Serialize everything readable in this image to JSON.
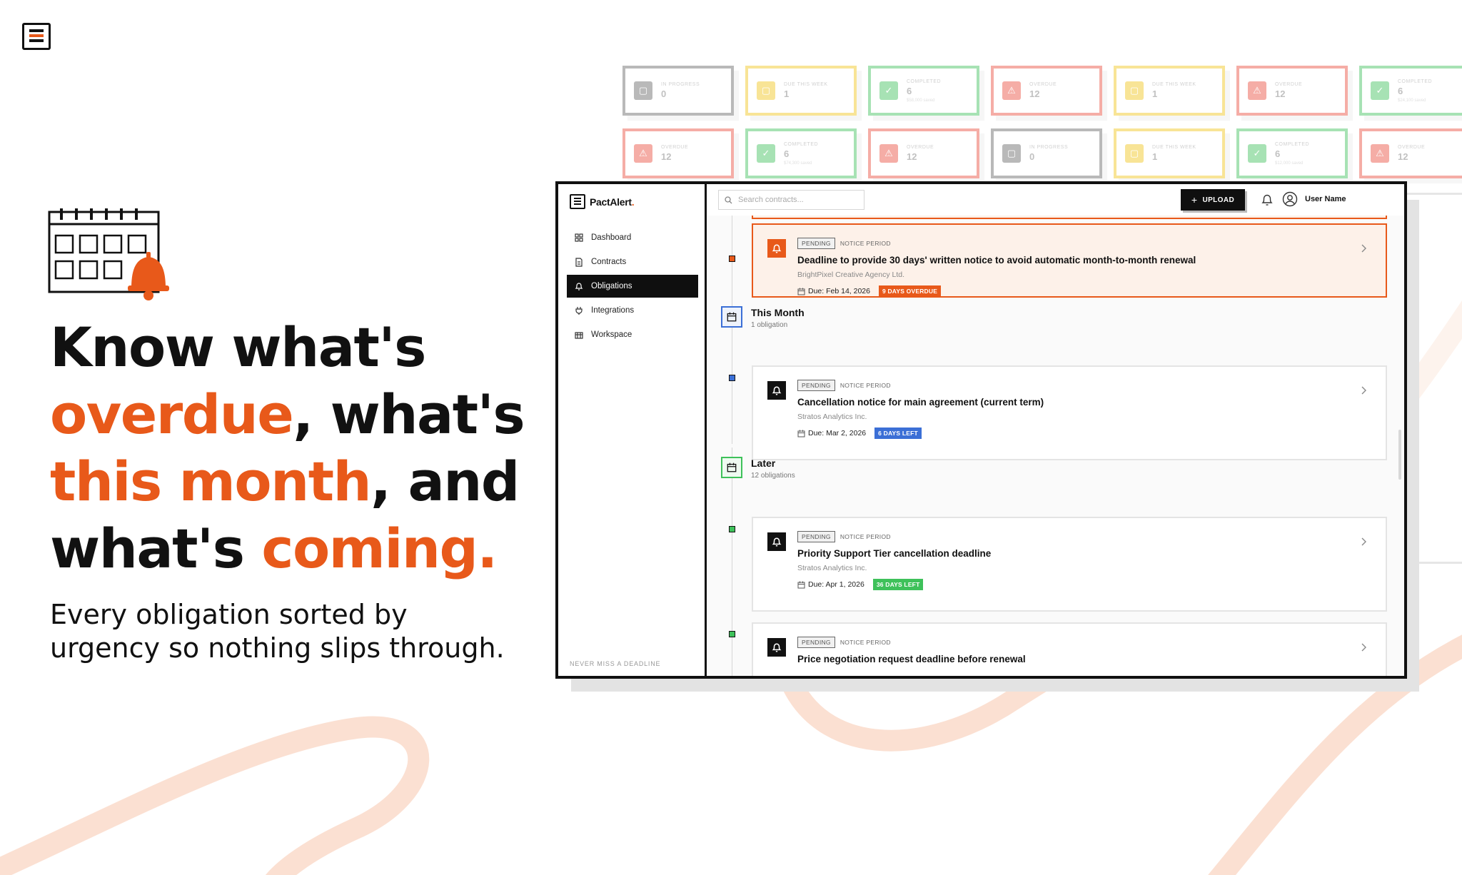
{
  "hero": {
    "heading_line1": "Know what's",
    "heading_line2_accent": "overdue",
    "heading_line2_rest": ", what's",
    "heading_line3_accent": "this month",
    "heading_line3_rest": ", and",
    "heading_line4_start": "what's ",
    "heading_line4_accent": "coming.",
    "subtitle_line1": "Every obligation sorted by",
    "subtitle_line2": "urgency so nothing slips through."
  },
  "background_tiles": [
    {
      "label": "IN PROGRESS",
      "value": "0",
      "sub": "",
      "color": "#666666"
    },
    {
      "label": "DUE THIS WEEK",
      "value": "1",
      "sub": "",
      "color": "#f0c419"
    },
    {
      "label": "COMPLETED",
      "value": "6",
      "sub": "$58,000 saved",
      "color": "#3ec15a"
    },
    {
      "label": "OVERDUE",
      "value": "12",
      "sub": "",
      "color": "#e94b3c"
    },
    {
      "label": "DUE THIS WEEK",
      "value": "1",
      "sub": "",
      "color": "#f0c419"
    },
    {
      "label": "OVERDUE",
      "value": "12",
      "sub": "",
      "color": "#e94b3c"
    },
    {
      "label": "COMPLETED",
      "value": "6",
      "sub": "$24,100 saved",
      "color": "#3ec15a"
    },
    {
      "label": "OVERDUE",
      "value": "12",
      "sub": "",
      "color": "#e94b3c"
    },
    {
      "label": "COMPLETED",
      "value": "6",
      "sub": "$74,300 saved",
      "color": "#3ec15a"
    },
    {
      "label": "OVERDUE",
      "value": "12",
      "sub": "",
      "color": "#e94b3c"
    },
    {
      "label": "IN PROGRESS",
      "value": "0",
      "sub": "",
      "color": "#666666"
    },
    {
      "label": "DUE THIS WEEK",
      "value": "1",
      "sub": "",
      "color": "#f0c419"
    },
    {
      "label": "COMPLETED",
      "value": "6",
      "sub": "$12,000 saved",
      "color": "#3ec15a"
    },
    {
      "label": "OVERDUE",
      "value": "12",
      "sub": "",
      "color": "#e94b3c"
    }
  ],
  "app": {
    "name": "PactAlert",
    "name_dot": ".",
    "search_placeholder": "Search contracts...",
    "upload_label": "UPLOAD",
    "user_name": "User Name",
    "nav": [
      {
        "label": "Dashboard",
        "icon": "grid-icon",
        "active": false
      },
      {
        "label": "Contracts",
        "icon": "document-icon",
        "active": false
      },
      {
        "label": "Obligations",
        "icon": "bell-icon",
        "active": true
      },
      {
        "label": "Integrations",
        "icon": "plug-icon",
        "active": false
      },
      {
        "label": "Workspace",
        "icon": "building-icon",
        "active": false
      }
    ],
    "footer": "NEVER MISS A DEADLINE"
  },
  "colors": {
    "accent": "#e8591a",
    "overdue_badge": "#e8591a",
    "days_left_blue": "#3b6fd6",
    "days_left_green": "#3ec15a"
  },
  "groups": {
    "this_month": {
      "title": "This Month",
      "count": "1 obligation"
    },
    "later": {
      "title": "Later",
      "count": "12 obligations"
    }
  },
  "cards": [
    {
      "status": "PENDING",
      "type": "NOTICE PERIOD",
      "title": "Deadline to provide 30 days' written notice to avoid automatic month-to-month renewal",
      "company": "BrightPixel Creative Agency Ltd.",
      "due": "Due: Feb 14, 2026",
      "badge": "9 DAYS OVERDUE"
    },
    {
      "status": "PENDING",
      "type": "NOTICE PERIOD",
      "title": "Cancellation notice for main agreement (current term)",
      "company": "Stratos Analytics Inc.",
      "due": "Due: Mar 2, 2026",
      "badge": "6 DAYS LEFT"
    },
    {
      "status": "PENDING",
      "type": "NOTICE PERIOD",
      "title": "Priority Support Tier cancellation deadline",
      "company": "Stratos Analytics Inc.",
      "due": "Due: Apr 1, 2026",
      "badge": "36 DAYS LEFT"
    },
    {
      "status": "PENDING",
      "type": "NOTICE PERIOD",
      "title": "Price negotiation request deadline before renewal",
      "company": "",
      "due": "",
      "badge": ""
    }
  ]
}
